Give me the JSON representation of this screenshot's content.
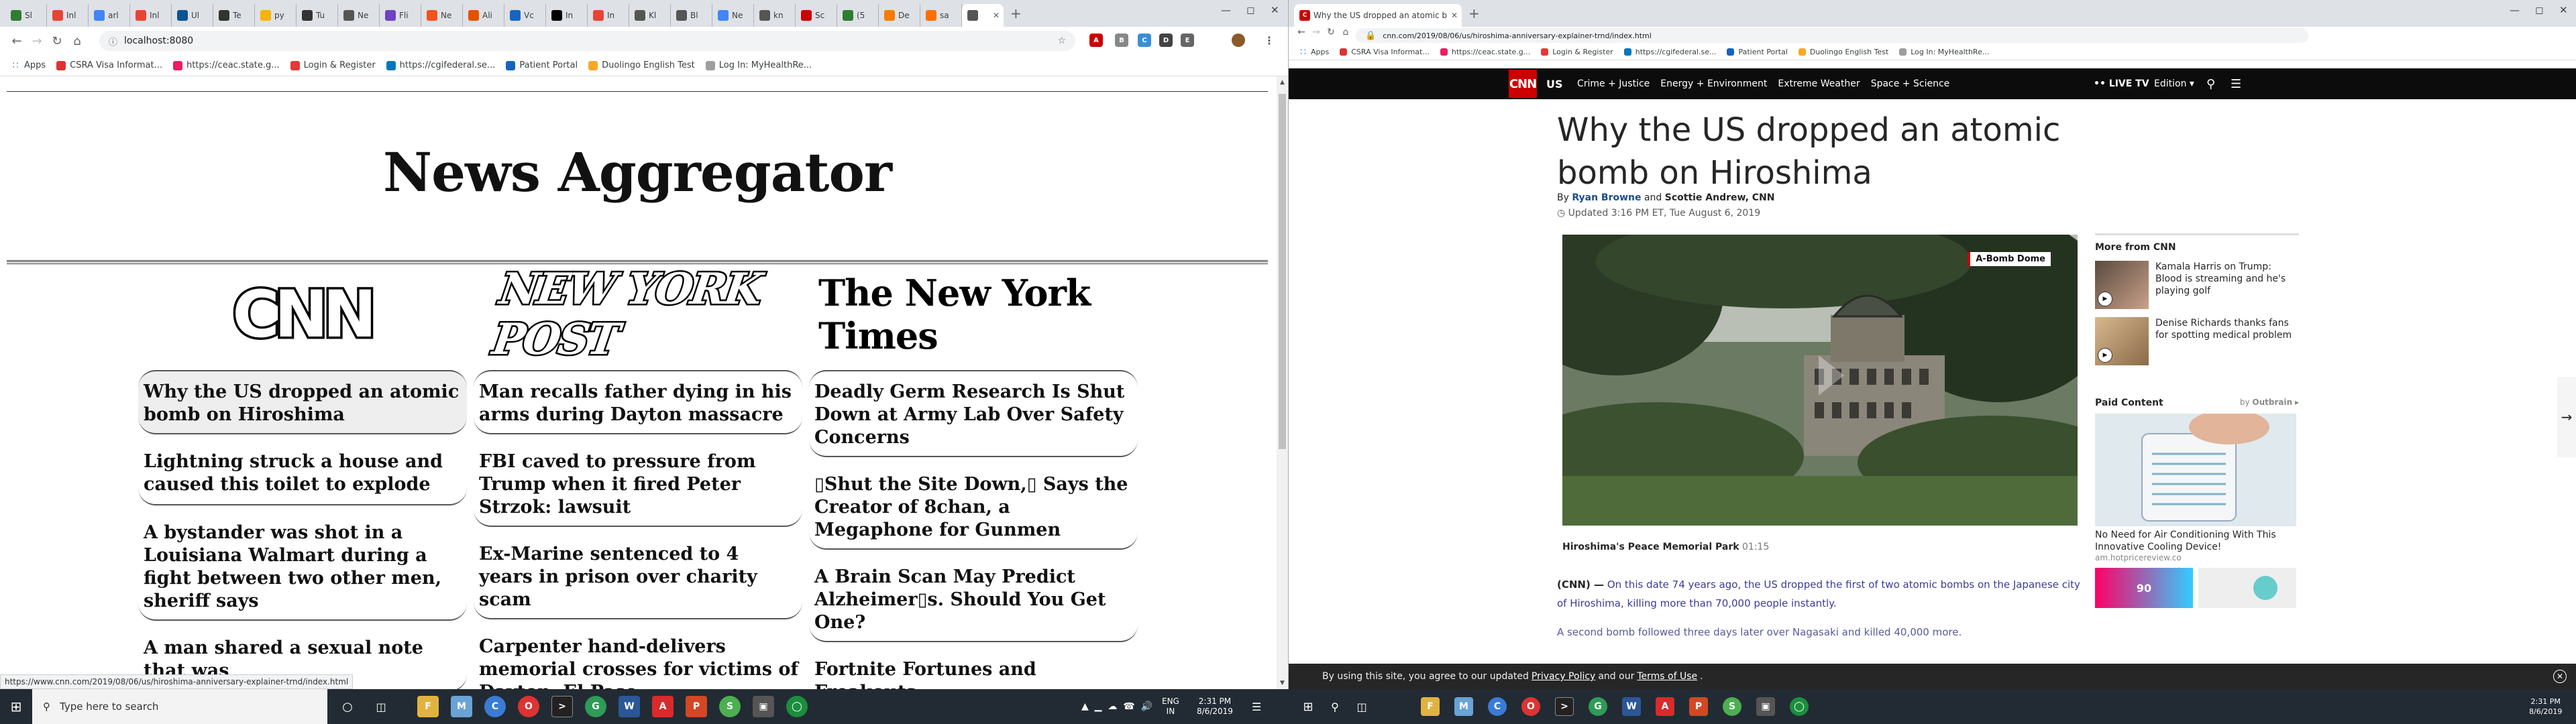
{
  "left": {
    "tabs": [
      "Sl",
      "Inl",
      "arl",
      "Inl",
      "Ul",
      "Te",
      "py",
      "Tu",
      "Ne",
      "Fli",
      "Ne",
      "Ali",
      "Vc",
      "In",
      "In",
      "Kl",
      "Bl",
      "Ne",
      "kn",
      "Sc",
      "(5",
      "De",
      "sa",
      ""
    ],
    "omnibox": "localhost:8080",
    "bookmarks": [
      "Apps",
      "CSRA Visa Informat...",
      "https://ceac.state.g...",
      "Login & Register",
      "https://cgifederal.se...",
      "Patient Portal",
      "Duolingo English Test",
      "Log In: MyHealthRe..."
    ],
    "page": {
      "title": "News Aggregator",
      "logos": {
        "cnn": "CNN",
        "nypost": "NEW YORK POST",
        "nyt": "The New York Times"
      },
      "cnn": [
        "Why the US dropped an atomic bomb on Hiroshima",
        "Lightning struck a house and caused this toilet to explode",
        "A bystander was shot in a Louisiana Walmart during a fight between two other men, sheriff says",
        "A man shared a sexual note that was"
      ],
      "nypost": [
        "Man recalls father dying in his arms during Dayton massacre",
        "FBI caved to pressure from Trump when it fired Peter Strzok: lawsuit",
        "Ex-Marine sentenced to 4 years in prison over charity scam",
        "Carpenter hand-delivers memorial crosses for victims of Dayton, El Paso"
      ],
      "nyt": [
        "Deadly Germ Research Is Shut Down at Army Lab Over Safety Concerns",
        "▯Shut the Site Down,▯ Says the Creator of 8chan, a Megaphone for Gunmen",
        "A Brain Scan May Predict Alzheimer▯s. Should You Get One?",
        "Fortnite Fortunes and Freakouts:"
      ]
    },
    "status_url": "https://www.cnn.com/2019/08/06/us/hiroshima-anniversary-explainer-trnd/index.html"
  },
  "right": {
    "tab_title": "Why the US dropped an atomic b",
    "omnibox": "cnn.com/2019/08/06/us/hiroshima-anniversary-explainer-trnd/index.html",
    "bookmarks": [
      "Apps",
      "CSRA Visa Informat...",
      "https://ceac.state.g...",
      "Login & Register",
      "https://cgifederal.se...",
      "Patient Portal",
      "Duolingo English Test",
      "Log In: MyHealthRe..."
    ],
    "nav": {
      "logo": "CNN",
      "section": "US",
      "items": [
        "Crime + Justice",
        "Energy + Environment",
        "Extreme Weather",
        "Space + Science"
      ],
      "live": "LIVE TV",
      "edition": "Edition"
    },
    "article": {
      "headline": "Why the US dropped an atomic bomb on Hiroshima",
      "by": "By",
      "author1": "Ryan Browne",
      "and": "and",
      "author2": "Scottie Andrew, CNN",
      "updated": "Updated 3:16 PM ET, Tue August 6, 2019",
      "video_tag": "A-Bomb Dome",
      "caption": "Hiroshima's Peace Memorial Park",
      "duration": "01:15",
      "lead_tag": "(CNN) —",
      "lead": "On this date 74 years ago, the US dropped the first of two atomic bombs on the Japanese city of Hiroshima, killing more than 70,000 people instantly.",
      "para2": "A second bomb followed three days later over Nagasaki and killed 40,000 more."
    },
    "rail": {
      "more_title": "More from CNN",
      "items": [
        "Kamala Harris on Trump: Blood is streaming and he's playing golf",
        "Denise Richards thanks fans for spotting medical problem"
      ],
      "paid_title": "Paid Content",
      "by": "by",
      "outbrain": "Outbrain",
      "ad_text": "No Need for Air Conditioning With This Innovative Cooling Device!",
      "ad_src": "am.hotpricereview.co",
      "ad2_label": "90"
    },
    "cookie": {
      "text": "By using this site, you agree to our updated",
      "policy": "Privacy Policy",
      "and": "and our",
      "terms": "Terms of Use",
      "dot": "."
    }
  },
  "taskbar": {
    "search_placeholder": "Type here to search",
    "lang1": "ENG",
    "lang2": "IN",
    "time": "2:31 PM",
    "date": "8/6/2019",
    "time_r": "2:31 PM",
    "date_r": "8/6/2019"
  },
  "colors": {
    "cnn_red": "#cc0000",
    "taskbar": "#222b33",
    "tabbar": "#dee1e6"
  }
}
